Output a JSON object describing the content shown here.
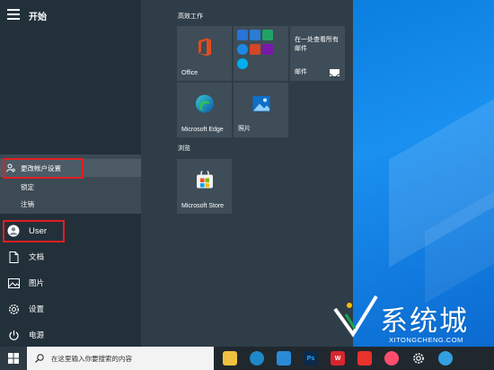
{
  "start_menu": {
    "title": "开始",
    "account_flyout": {
      "items": [
        {
          "label": "更改帐户设置",
          "icon": "person-gear-icon"
        },
        {
          "label": "锁定",
          "icon": "lock-icon"
        },
        {
          "label": "注销",
          "icon": "sign-out-icon"
        }
      ]
    },
    "user_name": "User",
    "left_items": [
      {
        "label": "文档",
        "icon": "document-icon"
      },
      {
        "label": "图片",
        "icon": "picture-icon"
      },
      {
        "label": "设置",
        "icon": "gear-icon"
      },
      {
        "label": "电源",
        "icon": "power-icon"
      }
    ],
    "groups": {
      "productivity": "高效工作",
      "explore": "浏览"
    },
    "tiles": {
      "office": "Office",
      "mail_title": "在一处查看所有邮件",
      "mail": "邮件",
      "edge": "Microsoft Edge",
      "photos": "照片",
      "store": "Microsoft Store"
    }
  },
  "taskbar": {
    "search_placeholder": "在这里输入你要搜索的内容",
    "apps": [
      "file-explorer-icon",
      "edge-icon",
      "wps-icon",
      "photoshop-icon",
      "wps-office-icon",
      "taobao-icon",
      "media-icon",
      "settings-icon",
      "app-icon"
    ]
  },
  "watermark": {
    "text": "系统城",
    "sub": "XITONGCHENG.COM"
  },
  "colors": {
    "highlight_box": "#e01f1f",
    "start_bg": "#22303a",
    "tile_bg": "#3e4d58",
    "desktop_blue": "#0a7fe0"
  }
}
